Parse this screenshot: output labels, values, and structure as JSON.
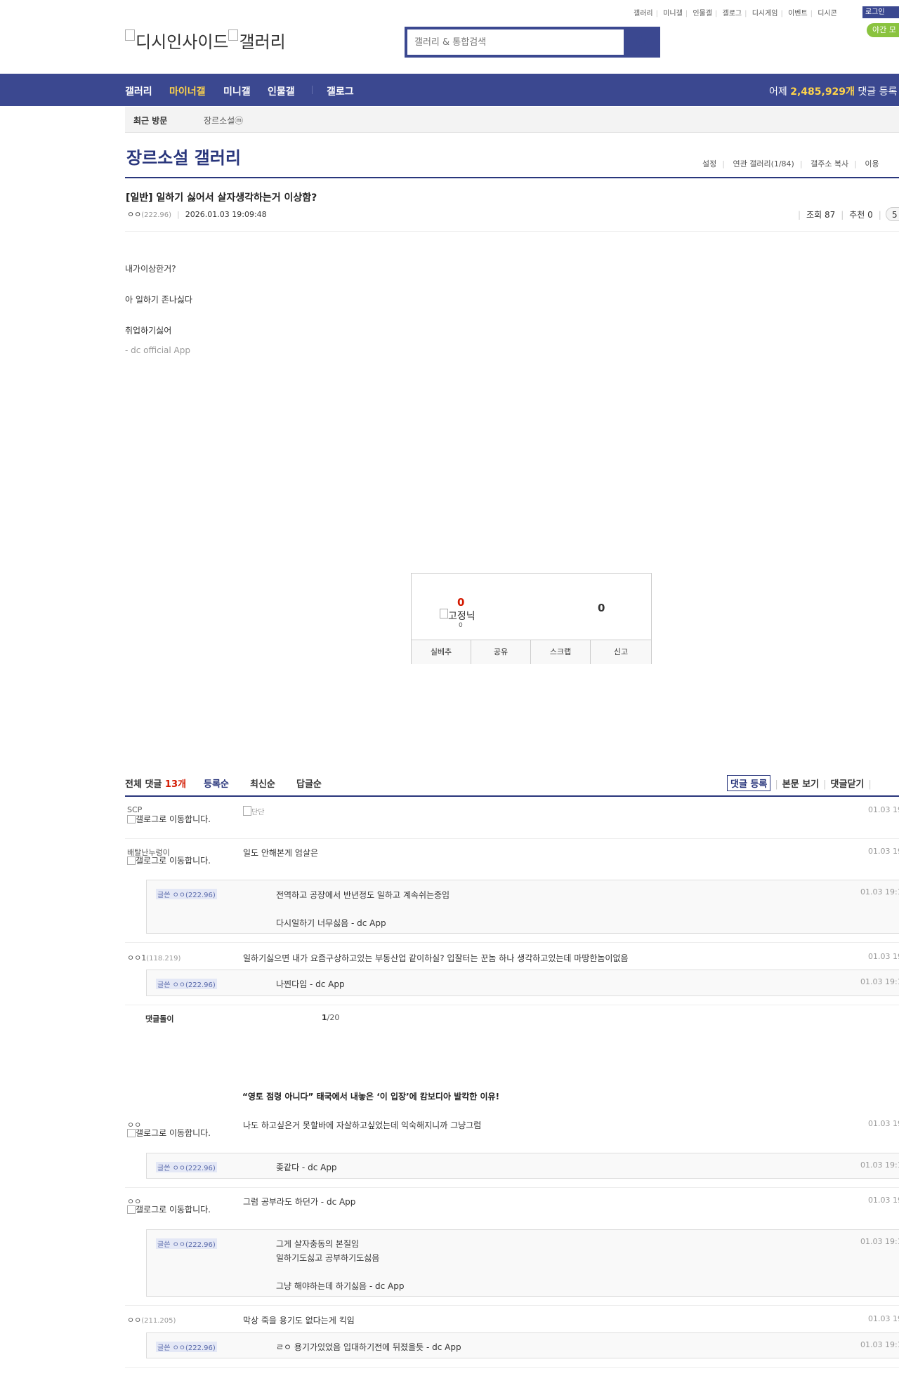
{
  "header": {
    "util_links": [
      "갤러리",
      "미니갤",
      "인물갤",
      "갤로그",
      "디시게임",
      "이벤트",
      "디시콘"
    ],
    "login_label": "로그인",
    "night_label": "야간 모",
    "logo_text_1": "디시인사이드",
    "logo_text_2": "갤러리",
    "search_placeholder": "갤러리 & 통합검색"
  },
  "gnb": {
    "items": [
      "갤러리",
      "마이너갤",
      "미니갤",
      "인물갤",
      "갤로그"
    ],
    "yesterday_prefix": "어제",
    "yesterday_count": "2,485,929개",
    "yesterday_suffix": "댓글 등록"
  },
  "lnb": {
    "recent_label": "최근 방문",
    "visited": "장르소설ⓜ"
  },
  "gallery": {
    "title": "장르소설 갤러리",
    "links": [
      "설정",
      "연관 갤러리(1/84)",
      "갤주소 복사",
      "이용"
    ]
  },
  "post": {
    "title": "[일반] 일하기 싫어서 살자생각하는거 이상함?",
    "writer": "ㅇㅇ",
    "ip": "(222.96)",
    "date": "2026.01.03 19:09:48",
    "views": "조회 87",
    "recommend": "추천 0",
    "comment_count_pill": "5",
    "body": [
      "내가이상한거?",
      "아 일하기 존나싫다",
      "취업하기싫어"
    ],
    "app_sign": "- dc official App"
  },
  "recommend_box": {
    "up_count": "0",
    "fixed_nick_alt": "고정닉",
    "fixed_count": "0",
    "down_count": "0",
    "buttons": [
      "실베추",
      "공유",
      "스크랩",
      "신고"
    ]
  },
  "comments_header": {
    "label": "전체 댓글",
    "count": "13개",
    "sorts": [
      "등록순",
      "최신순",
      "답글순"
    ],
    "tools": [
      "댓글 등록",
      "본문 보기",
      "댓글닫기"
    ]
  },
  "comments": [
    {
      "nick": "SCP",
      "gallog": "갤로그로 이동합니다.",
      "text": "",
      "dccon_alt": "단단",
      "date": "01.03 19"
    },
    {
      "nick": "배탈난누렁이",
      "gallog": "갤로그로 이동합니다.",
      "text": "일도 안해본게 엄살은",
      "date": "01.03 19",
      "reply": {
        "nick": "글쓴 ㅇㅇ(222.96)",
        "lines": [
          "전역하고 공장에서 반년정도 일하고 계속쉬는중임",
          "다시일하기 너무싫음 - dc App"
        ],
        "date": "01.03 19:1"
      }
    },
    {
      "nick": "ㅇㅇ1",
      "ip": "(118.219)",
      "text": "일하기싫으면 내가 요즘구상하고있는 부동산업 같이하실? 입잘터는 꾼놈 하나 생각하고있는데 마땅한놈이없음",
      "date": "01.03 19",
      "reply": {
        "nick": "글쓴 ㅇㅇ(222.96)",
        "lines": [
          "나찐다임 - dc App"
        ],
        "date": "01.03 19:1"
      }
    },
    {
      "nick": "ㅇㅇ",
      "gallog": "갤로그로 이동합니다.",
      "text": "나도 하고싶은거 못할바에 자살하고싶었는데 익숙해지니까 그냥그럼",
      "date": "01.03 19",
      "reply": {
        "nick": "글쓴 ㅇㅇ(222.96)",
        "lines": [
          "좆같다 - dc App"
        ],
        "date": "01.03 19:1"
      }
    },
    {
      "nick": "ㅇㅇ",
      "gallog": "갤로그로 이동합니다.",
      "text": "그럼 공부라도 하던가 - dc App",
      "date": "01.03 19",
      "reply": {
        "nick": "글쓴 ㅇㅇ(222.96)",
        "lines": [
          "그게 살자충동의 본질임",
          "일하기도싫고 공부하기도싫음",
          "그냥 해야하는데 하기싫음 - dc App"
        ],
        "date": "01.03 19:1"
      }
    },
    {
      "nick": "ㅇㅇ",
      "ip": "(211.205)",
      "text": "막상 죽을 용기도 없다는게 킥임",
      "date": "01.03 19",
      "reply": {
        "nick": "글쓴 ㅇㅇ(222.96)",
        "lines": [
          "ㄹㅇ 용기가있었음 입대하기전에 뒤졌을듯 - dc App"
        ],
        "date": "01.03 19:1"
      }
    }
  ],
  "dolbot": {
    "label": "댓글돌이",
    "page": "1",
    "total": "/20"
  },
  "ad": {
    "title": "“영토 점령 아니다” 태국에서 내놓은 ‘이 입장’에 캄보디아 발칵한 이유!"
  },
  "colors": {
    "brand": "#3b4890",
    "accent": "#ffd44a",
    "count_red": "#d31900",
    "night": "#8ac33f"
  }
}
